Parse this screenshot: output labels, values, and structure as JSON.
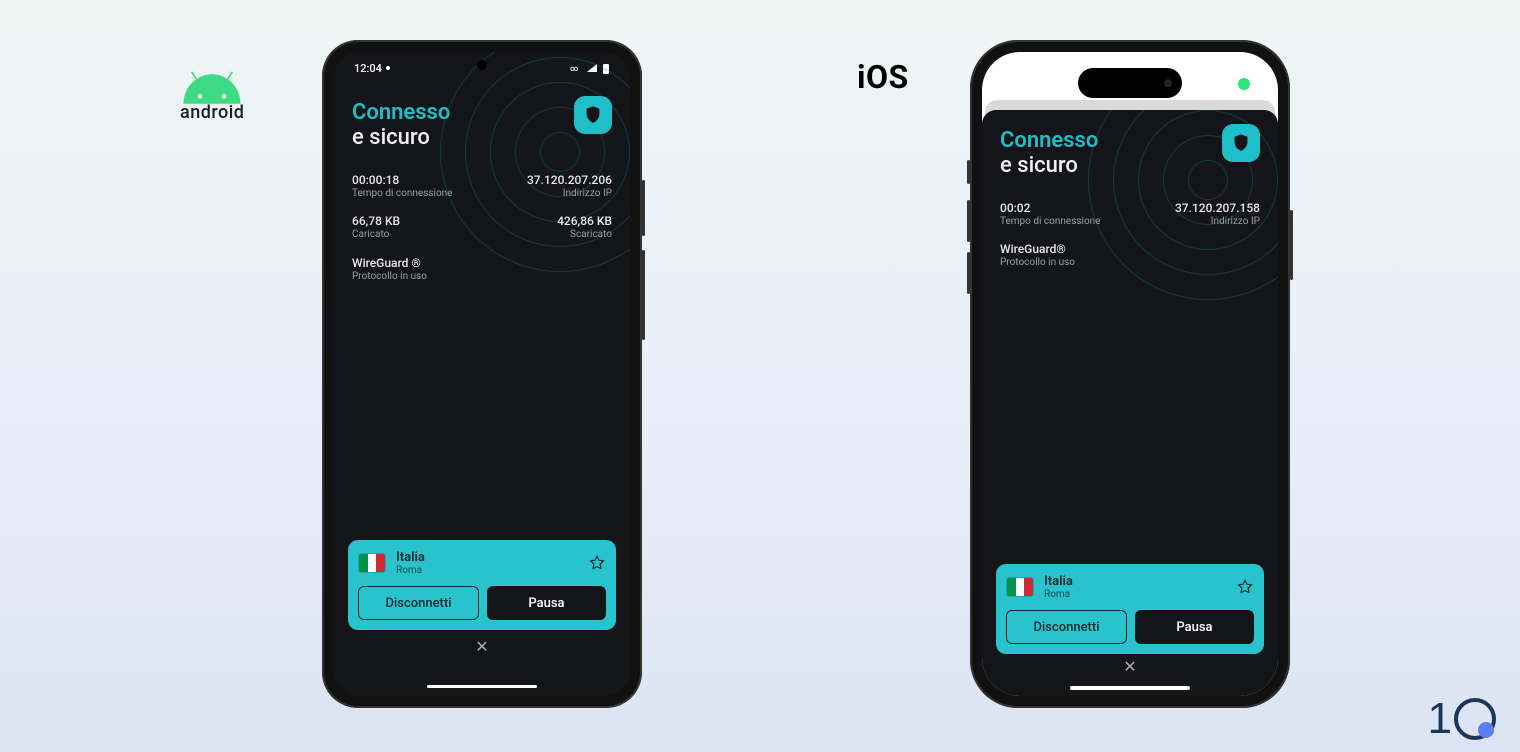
{
  "labels": {
    "android": "android",
    "ios": "iOS"
  },
  "android": {
    "status": {
      "time": "12:04",
      "icons": "∞ ▾ ▮"
    },
    "title_connected": "Connesso",
    "title_secure": "e sicuro",
    "stats": {
      "conn_time_val": "00:00:18",
      "conn_time_lab": "Tempo di connessione",
      "ip_val": "37.120.207.206",
      "ip_lab": "Indirizzo IP",
      "upload_val": "66,78 KB",
      "upload_lab": "Caricato",
      "download_val": "426,86 KB",
      "download_lab": "Scaricato",
      "proto_val": "WireGuard ®",
      "proto_lab": "Protocollo in uso"
    },
    "server": {
      "country": "Italia",
      "city": "Roma"
    },
    "buttons": {
      "disconnect": "Disconnetti",
      "pause": "Pausa"
    }
  },
  "ios": {
    "title_connected": "Connesso",
    "title_secure": "e sicuro",
    "stats": {
      "conn_time_val": "00:02",
      "conn_time_lab": "Tempo di connessione",
      "ip_val": "37.120.207.158",
      "ip_lab": "Indirizzo IP",
      "proto_val": "WireGuard®",
      "proto_lab": "Protocollo in uso"
    },
    "server": {
      "country": "Italia",
      "city": "Roma"
    },
    "buttons": {
      "disconnect": "Disconnetti",
      "pause": "Pausa"
    }
  }
}
